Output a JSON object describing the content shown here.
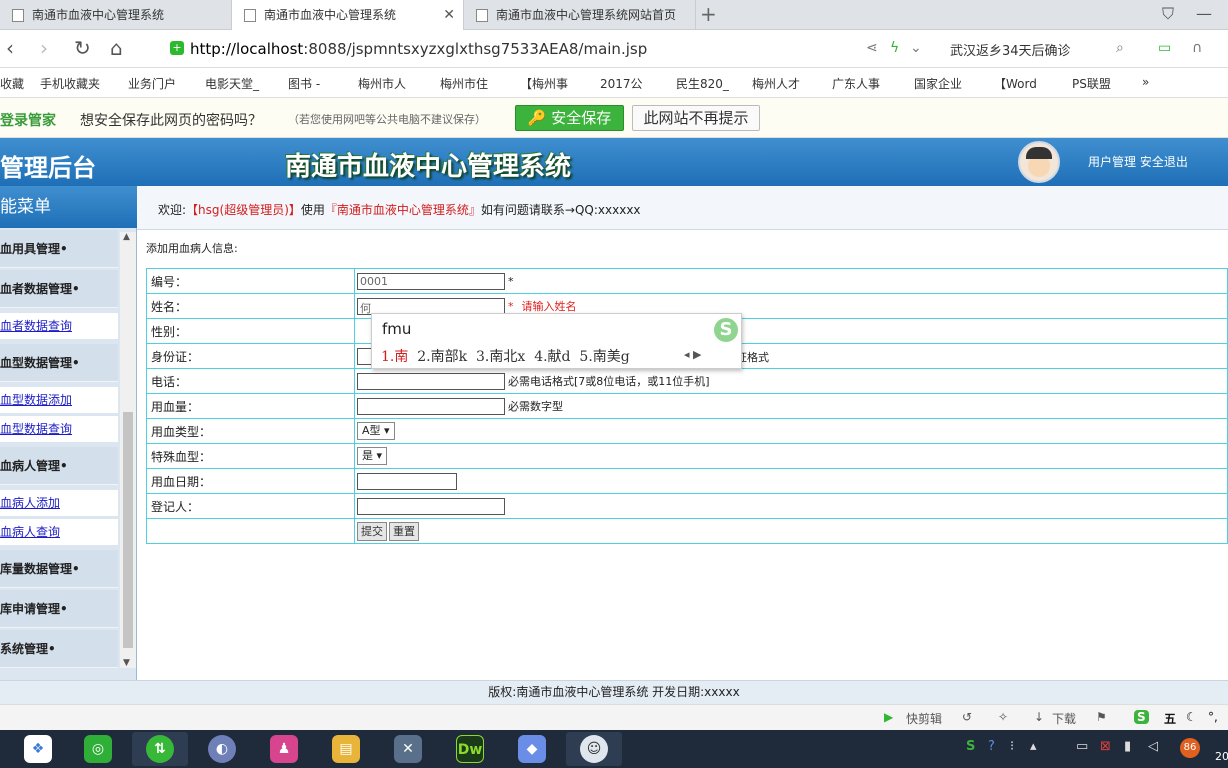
{
  "browser": {
    "tabs": [
      {
        "label": "南通市血液中心管理系统",
        "active": false
      },
      {
        "label": "南通市血液中心管理系统",
        "active": true
      },
      {
        "label": "南通市血液中心管理系统网站首页",
        "active": false
      }
    ],
    "new_tab": "+",
    "url_host": "http://localhost",
    "url_rest": ":8088/jspmntsxyzxglxthsg7533AEA8/main.jsp",
    "news_ticker": "武汉返乡34天后确诊",
    "bookmarks": [
      "收藏",
      "手机收藏夹",
      "业务门户",
      "电影天堂_",
      "图书 -",
      "梅州市人",
      "梅州市住",
      "【梅州事",
      "2017公",
      "民生820_",
      "梅州人才",
      "广东人事",
      "国家企业",
      "【Word",
      "PS联盟"
    ],
    "password_bar": {
      "brand": "登录管家",
      "question": "想安全保存此网页的密码吗？",
      "note": "（若您使用网吧等公共电脑不建议保存）",
      "save_button": "安全保存",
      "never_button": "此网站不再提示"
    },
    "status_items": [
      "快剪辑",
      "下载"
    ]
  },
  "app": {
    "left_title": "管理后台",
    "title": "南通市血液中心管理系统",
    "user_links": "用户管理 安全退出",
    "sidebar": {
      "header": "能菜单",
      "items": [
        {
          "type": "sect",
          "label": "血用具管理•"
        },
        {
          "type": "sect",
          "label": "血者数据管理•"
        },
        {
          "type": "sub",
          "label": "血者数据查询"
        },
        {
          "type": "sect",
          "label": "血型数据管理•"
        },
        {
          "type": "sub",
          "label": "血型数据添加"
        },
        {
          "type": "sub",
          "label": "血型数据查询"
        },
        {
          "type": "sect",
          "label": "血病人管理•"
        },
        {
          "type": "sub",
          "label": "血病人添加"
        },
        {
          "type": "sub",
          "label": "血病人查询"
        },
        {
          "type": "sect",
          "label": "库量数据管理•"
        },
        {
          "type": "sect",
          "label": "库申请管理•"
        },
        {
          "type": "sect",
          "label": "系统管理•"
        }
      ]
    },
    "welcome": {
      "prefix": "欢迎:",
      "user": "【hsg(超级管理员)】",
      "mid": "使用",
      "system": "『南通市血液中心管理系统』",
      "suffix": "如有问题请联系→QQ:xxxxxx"
    },
    "form": {
      "title": "添加用血病人信息:",
      "rows": [
        {
          "label": "编号：",
          "value": "0001",
          "note": "*"
        },
        {
          "label": "姓名：",
          "value": "何",
          "note": "*",
          "error": "请输入姓名"
        },
        {
          "label": "性别："
        },
        {
          "label": "身份证：",
          "note_tail": "证格式"
        },
        {
          "label": "电话：",
          "note": "必需电话格式[7或8位电话，或11位手机]"
        },
        {
          "label": "用血量：",
          "note": "必需数字型"
        },
        {
          "label": "用血类型：",
          "select": "A型"
        },
        {
          "label": "特殊血型：",
          "select": "是"
        },
        {
          "label": "用血日期："
        },
        {
          "label": "登记人："
        }
      ],
      "submit": "提交",
      "reset": "重置"
    },
    "footer": "版权:南通市血液中心管理系统 开发日期:xxxxx"
  },
  "ime": {
    "input": "fmu",
    "candidates": [
      "1.南",
      "2.南部k",
      "3.南北x",
      "4.献d",
      "5.南美g"
    ],
    "logo": "S"
  },
  "taskbar": {
    "tray_badge": "86",
    "clock": "20"
  }
}
